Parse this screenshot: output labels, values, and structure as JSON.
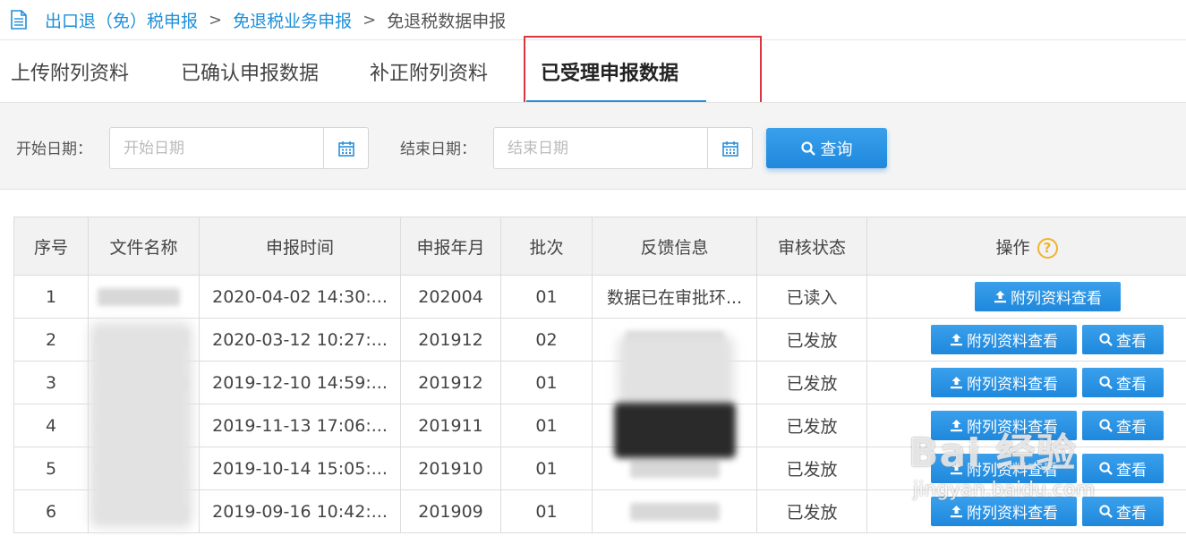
{
  "breadcrumb": {
    "items": [
      "出口退（免）税申报",
      "免退税业务申报",
      "免退税数据申报"
    ],
    "separator": ">"
  },
  "tabs": [
    {
      "label": "上传附列资料",
      "active": false
    },
    {
      "label": "已确认申报数据",
      "active": false
    },
    {
      "label": "补正附列资料",
      "active": false
    },
    {
      "label": "已受理申报数据",
      "active": true
    }
  ],
  "filters": {
    "start_label": "开始日期：",
    "start_placeholder": "开始日期",
    "end_label": "结束日期：",
    "end_placeholder": "结束日期",
    "query_label": "查询"
  },
  "table": {
    "headers": [
      "序号",
      "文件名称",
      "申报时间",
      "申报年月",
      "批次",
      "反馈信息",
      "审核状态",
      "操作"
    ],
    "rows": [
      {
        "no": "1",
        "time": "2020-04-02 14:30:...",
        "ym": "202004",
        "batch": "01",
        "feedback": "数据已在审批环...",
        "status": "已读入"
      },
      {
        "no": "2",
        "time": "2020-03-12 10:27:...",
        "ym": "201912",
        "batch": "02",
        "feedback": "",
        "status": "已发放"
      },
      {
        "no": "3",
        "time": "2019-12-10 14:59:...",
        "ym": "201912",
        "batch": "01",
        "feedback": "",
        "status": "已发放"
      },
      {
        "no": "4",
        "time": "2019-11-13 17:06:...",
        "ym": "201911",
        "batch": "01",
        "feedback": "",
        "status": "已发放"
      },
      {
        "no": "5",
        "time": "2019-10-14 15:05:...",
        "ym": "201910",
        "batch": "01",
        "feedback": "",
        "status": "已发放"
      },
      {
        "no": "6",
        "time": "2019-09-16 10:42:...",
        "ym": "201909",
        "batch": "01",
        "feedback": "",
        "status": "已发放"
      }
    ],
    "attach_label": "附列资料查看",
    "view_label": "查看"
  },
  "watermark": {
    "main": "Bai 经验",
    "sub": "jingyan.baidu.com"
  },
  "colors": {
    "accent": "#1e8fd8",
    "button": "#2b8fd9",
    "highlight": "#d9363e",
    "help": "#f0b429"
  }
}
